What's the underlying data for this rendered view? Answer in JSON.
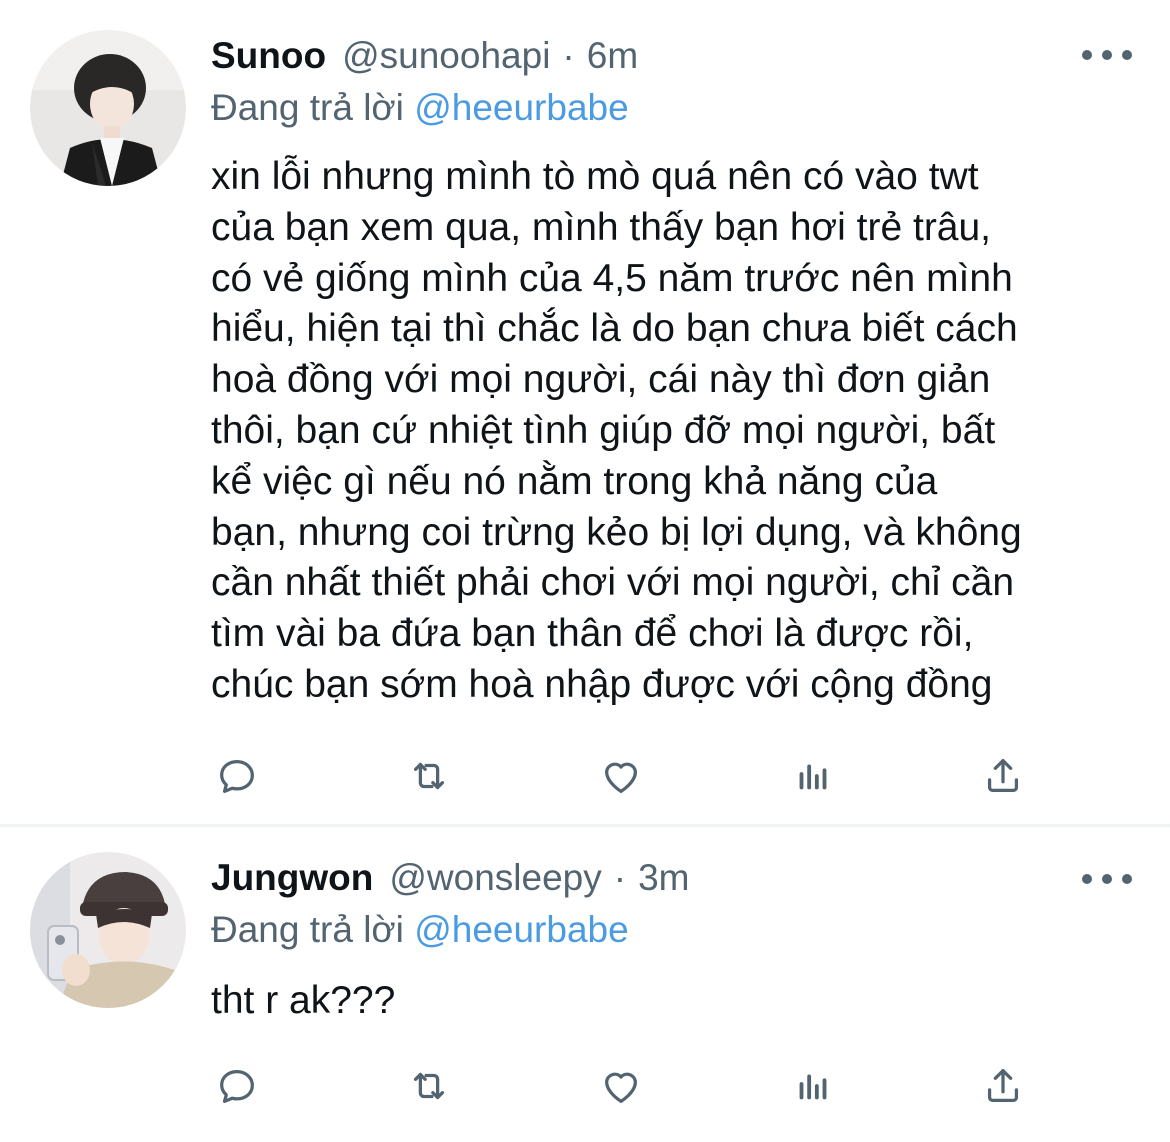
{
  "tweets": [
    {
      "display_name": "Sunoo",
      "handle": "@sunoohapi",
      "separator": "·",
      "time": "6m",
      "reply_prefix": "Đang trả lời",
      "reply_mention": "@heeurbabe",
      "body_lines": [
        "xin lỗi nhưng mình tò mò quá nên có vào twt",
        "của bạn xem qua, mình thấy bạn hơi trẻ trâu,",
        "có vẻ giống mình của 4,5 năm trước nên mình",
        "hiểu, hiện tại thì chắc là do bạn chưa biết cách",
        "hoà đồng với mọi người, cái này thì đơn giản",
        "thôi, bạn cứ nhiệt tình giúp đỡ mọi người, bất",
        "kể việc gì nếu nó nằm trong khả năng của",
        "bạn, nhưng coi trừng kẻo bị lợi dụng, và không",
        "cần nhất thiết phải chơi với mọi người, chỉ cần",
        "tìm vài ba đứa bạn thân để chơi là được rồi,",
        "chúc bạn sớm hoà nhập được với cộng đồng"
      ]
    },
    {
      "display_name": "Jungwon",
      "handle": "@wonsleepy",
      "separator": "·",
      "time": "3m",
      "reply_prefix": "Đang trả lời",
      "reply_mention": "@heeurbabe",
      "body_lines": [
        "tht r ak???"
      ]
    }
  ],
  "icons": {
    "reply": "speech-bubble-icon",
    "retweet": "retweet-arrows-icon",
    "like": "heart-icon",
    "stats": "bar-chart-icon",
    "share": "share-upload-icon",
    "more": "more-dots-icon"
  },
  "colors": {
    "text": "#0f1419",
    "secondary": "#536471",
    "mention": "#4b9be2",
    "divider": "#eff3f4"
  }
}
